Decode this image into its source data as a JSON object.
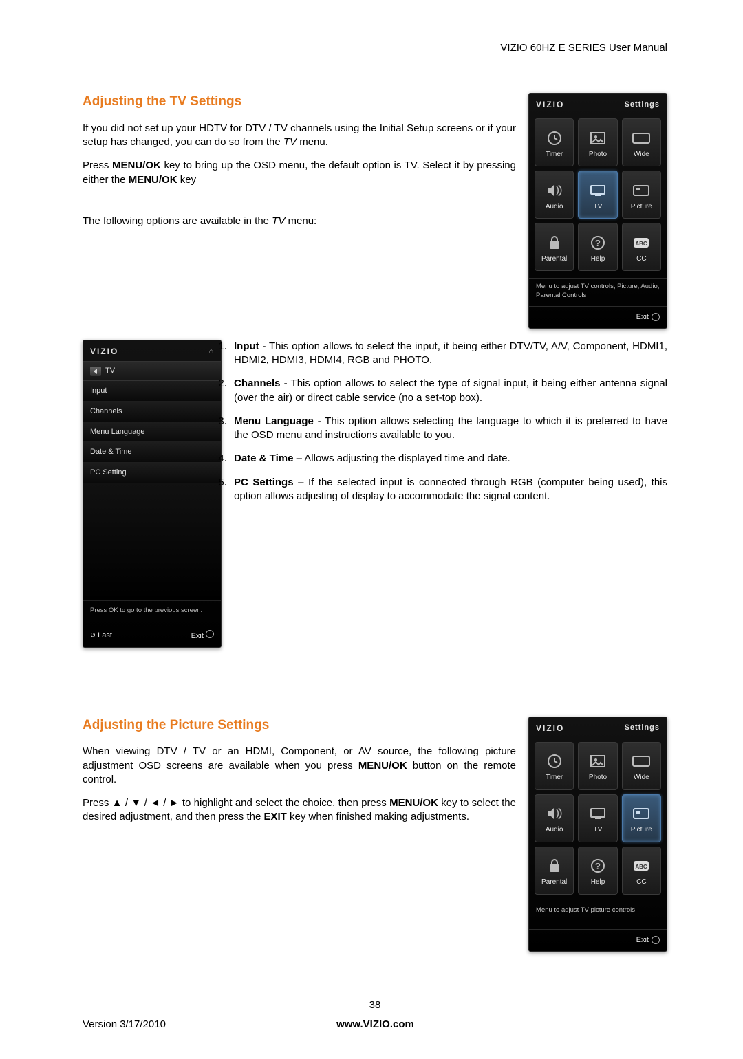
{
  "header": {
    "manual_title": "VIZIO 60HZ E SERIES User Manual"
  },
  "section1": {
    "heading": "Adjusting the TV Settings",
    "p1_a": "If you did not set up your HDTV for DTV / TV channels using the Initial Setup screens or if your setup has changed, you can do so from the ",
    "p1_em": "TV",
    "p1_b": " menu.",
    "p2_a": "Press ",
    "p2_bold": "MENU/OK",
    "p2_b": " key to bring up the OSD menu, the default option is TV. Select it by pressing either the ",
    "p2_bold2": "MENU/OK",
    "p2_c": " key",
    "p3_a": "The following options are available in the ",
    "p3_em": "TV",
    "p3_b": " menu:",
    "list": {
      "i1_b": "Input",
      "i1_t": " -  This option allows to select the input, it being either DTV/TV, A/V, Component, HDMI1, HDMI2, HDMI3, HDMI4, RGB and PHOTO.",
      "i2_b": "Channels",
      "i2_t": " - This option allows to select the type of signal input, it being either antenna signal (over the air) or direct cable service (no a set-top box).",
      "i3_b": "Menu Language",
      "i3_t": " - This option allows selecting the language to which it is preferred to have the OSD menu and instructions available to you.",
      "i4_b": "Date & Time",
      "i4_t": " – Allows adjusting the displayed time and date.",
      "i5_b": "PC Settings",
      "i5_t": " – If the selected input is connected through RGB (computer being used), this option allows adjusting of display to accommodate the signal content."
    }
  },
  "section2": {
    "heading": "Adjusting the Picture Settings",
    "p1_a": "When viewing DTV / TV or an HDMI, Component, or AV source, the following picture adjustment OSD screens are available when you press ",
    "p1_bold": "MENU/OK",
    "p1_b": " button on the remote control.",
    "p2_a": "Press ",
    "p2_arrows": "▲ / ▼ / ◄ / ►",
    "p2_b": " to highlight and select the choice, then press ",
    "p2_bold": "MENU/OK",
    "p2_c": " key to select the desired adjustment, and then press the ",
    "p2_bold2": "EXIT",
    "p2_d": " key when finished making adjustments."
  },
  "osd": {
    "brand": "VIZIO",
    "settings_label": "Settings",
    "cells": {
      "timer": "Timer",
      "photo": "Photo",
      "wide": "Wide",
      "audio": "Audio",
      "tv": "TV",
      "picture": "Picture",
      "parental": "Parental",
      "help": "Help",
      "cc": "CC"
    },
    "hint1": "Menu to adjust TV controls, Picture, Audio, Parental Controls",
    "hint2": "Menu to adjust TV picture controls",
    "exit": "Exit",
    "last": "Last",
    "tvmenu": {
      "crumb": "TV",
      "rows": [
        "Input",
        "Channels",
        "Menu Language",
        "Date & Time",
        "PC Setting"
      ],
      "prompt": "Press OK to go to the previous screen."
    }
  },
  "footer": {
    "pagenum": "38",
    "version": "Version 3/17/2010",
    "site": "www.VIZIO.com"
  }
}
